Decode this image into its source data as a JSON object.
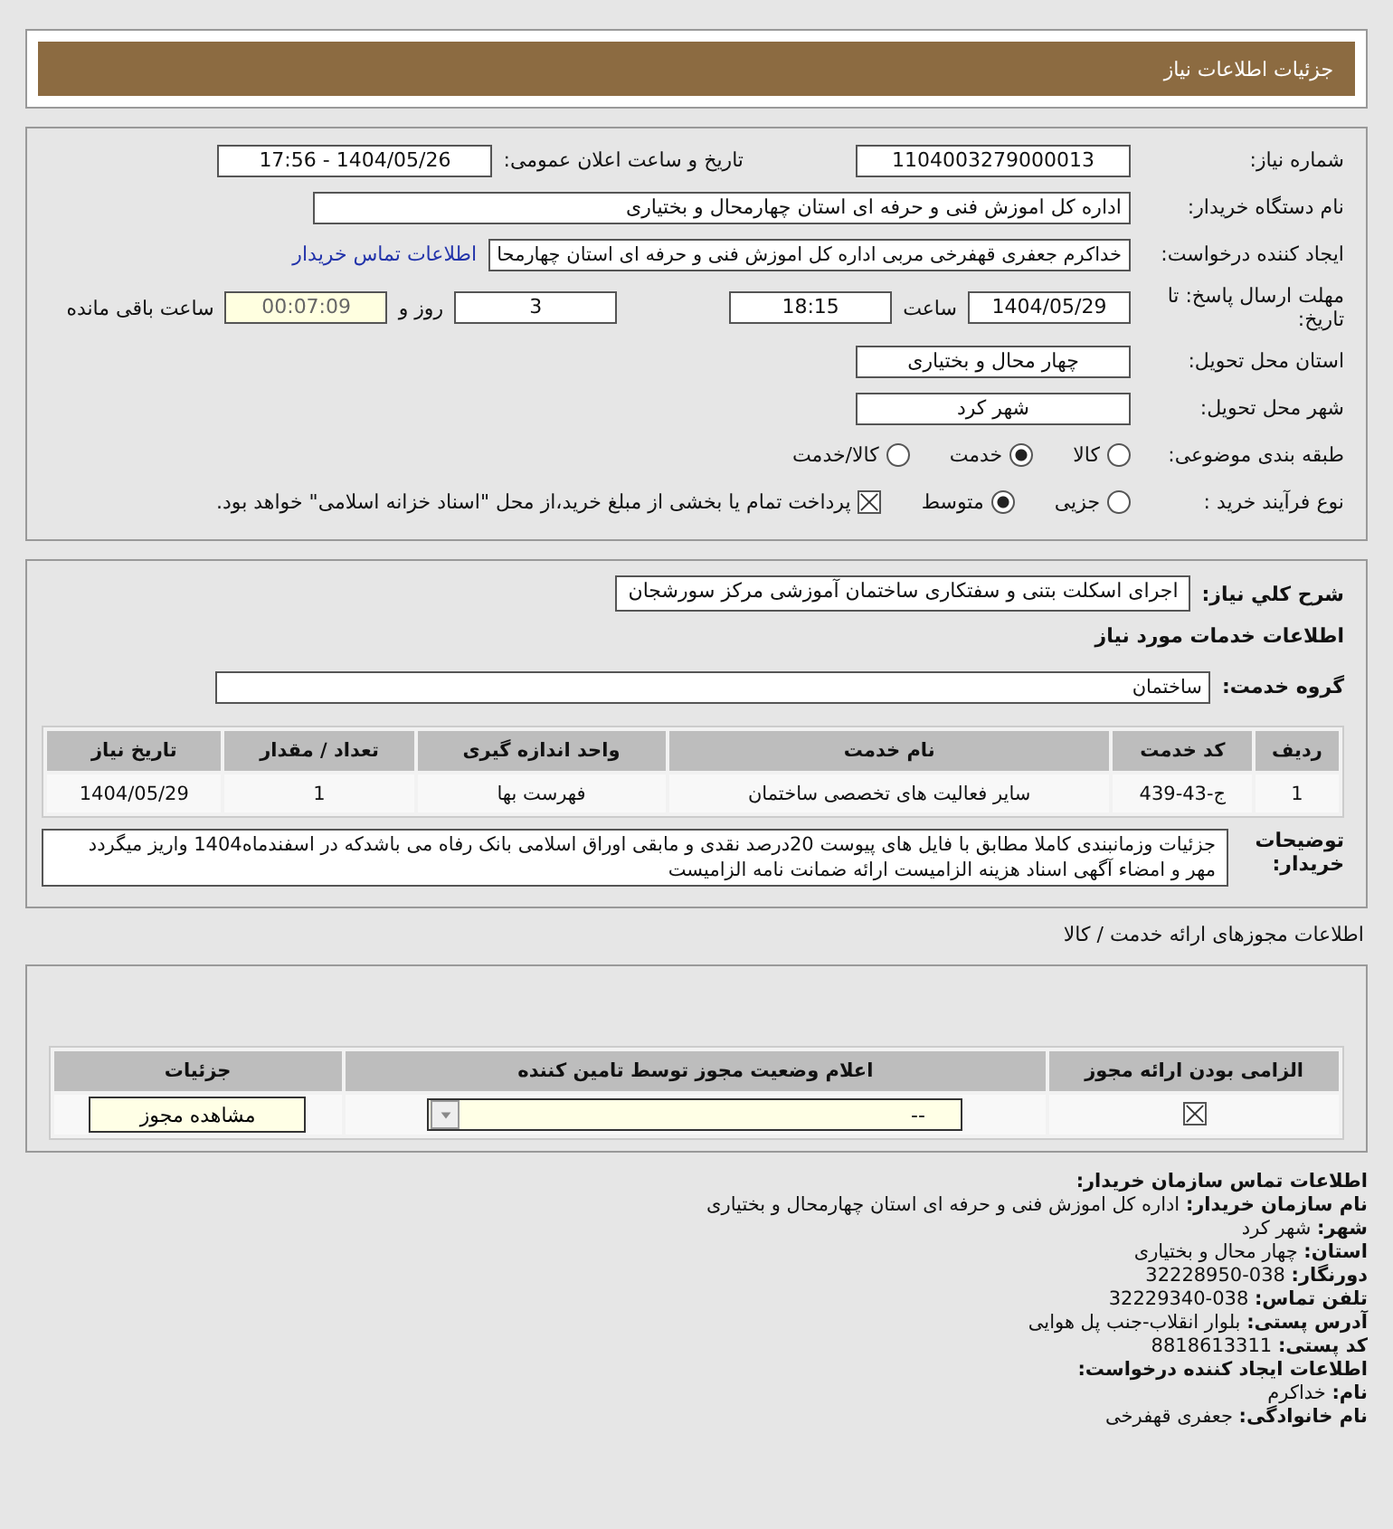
{
  "header": {
    "title": "جزئیات اطلاعات نیاز"
  },
  "form_rows": [
    {
      "items": [
        {
          "kind": "label",
          "text": "شماره نیاز:"
        },
        {
          "kind": "field",
          "value": "1104003279000013"
        },
        {
          "kind": "gap"
        },
        {
          "kind": "text",
          "text": "تاریخ و ساعت اعلان عمومی:"
        },
        {
          "kind": "field",
          "value": "1404/05/26 - 17:56"
        }
      ]
    },
    {
      "items": [
        {
          "kind": "label",
          "text": "نام دستگاه خریدار:"
        },
        {
          "kind": "field",
          "value": "اداره کل اموزش فنی و حرفه ای استان چهارمحال و بختیاری"
        }
      ]
    },
    {
      "items": [
        {
          "kind": "label",
          "text": "ایجاد کننده درخواست:"
        },
        {
          "kind": "field",
          "value": "خداکرم جعفری قهفرخی مربی اداره کل اموزش فنی و حرفه ای استان چهارمحا"
        },
        {
          "kind": "link",
          "text": "اطلاعات تماس خریدار"
        }
      ]
    },
    {
      "items": [
        {
          "kind": "label",
          "text": "مهلت ارسال پاسخ: تا تاریخ:"
        },
        {
          "kind": "field",
          "value": "1404/05/29"
        },
        {
          "kind": "text",
          "text": "ساعت"
        },
        {
          "kind": "field",
          "value": "18:15"
        },
        {
          "kind": "gap"
        },
        {
          "kind": "field",
          "value": "3"
        },
        {
          "kind": "text",
          "text": "روز و"
        },
        {
          "kind": "timer",
          "value": "00:07:09"
        },
        {
          "kind": "text",
          "text": "ساعت باقی مانده"
        }
      ]
    },
    {
      "items": [
        {
          "kind": "label",
          "text": "استان محل تحویل:"
        },
        {
          "kind": "field",
          "value": "چهار محال و بختیاری"
        }
      ]
    },
    {
      "items": [
        {
          "kind": "label",
          "text": "شهر محل تحویل:"
        },
        {
          "kind": "field",
          "value": "شهر کرد"
        }
      ]
    },
    {
      "items": [
        {
          "kind": "label",
          "text": "طبقه بندی موضوعی:"
        },
        {
          "kind": "radio",
          "text": "کالا",
          "selected": false
        },
        {
          "kind": "radio",
          "text": "خدمت",
          "selected": true
        },
        {
          "kind": "radio",
          "text": "کالا/خدمت",
          "selected": false
        }
      ]
    },
    {
      "items": [
        {
          "kind": "label",
          "text": "نوع فرآیند خرید :"
        },
        {
          "kind": "radio",
          "text": "جزیی",
          "selected": false
        },
        {
          "kind": "radio",
          "text": "متوسط",
          "selected": true
        },
        {
          "kind": "checkbox",
          "text": "پرداخت تمام یا بخشی از مبلغ خرید،از محل \"اسناد خزانه اسلامی\" خواهد بود.",
          "checked": true
        }
      ]
    }
  ],
  "need": {
    "label": "شرح کلي نیاز:",
    "value": "اجرای اسکلت بتنی و سفتکاری ساختمان آموزشی مرکز سورشجان"
  },
  "services_title": "اطلاعات خدمات مورد نیاز",
  "service_group": {
    "label": "گروه خدمت:",
    "value": "ساختمان"
  },
  "services_table": {
    "columns": [
      "ردیف",
      "کد خدمت",
      "نام خدمت",
      "واحد اندازه گیری",
      "تعداد / مقدار",
      "تاریخ نیاز"
    ],
    "rows": [
      [
        "1",
        "ج-43-439",
        "سایر فعالیت های تخصصی ساختمان",
        "فهرست بها",
        "1",
        "1404/05/29"
      ]
    ]
  },
  "buyer_notes": {
    "label": "توضیحات خریدار:",
    "text": "جزئیات وزمانبندی کاملا مطابق با فایل های پیوست 20درصد نقدی و مابقی اوراق اسلامی بانک رفاه می باشدکه در اسفندماه1404 واریز میگردد مهر و امضاء آگهی اسناد هزینه الزامیست ارائه ضمانت نامه الزامیست"
  },
  "permits_title": "اطلاعات مجوزهای ارائه خدمت / کالا",
  "permits_table": {
    "columns": [
      "الزامی بودن ارائه مجوز",
      "اعلام وضعیت مجوز توسط تامین کننده",
      "جزئیات"
    ],
    "rows": [
      {
        "required": true,
        "status": "--",
        "action": "مشاهده مجوز"
      }
    ]
  },
  "contact_lines": [
    {
      "kind": "heading",
      "text": "اطلاعات تماس سازمان خریدار:"
    },
    {
      "kind": "line",
      "text": "**نام سازمان خریدار:** اداره کل اموزش فنی و حرفه ای استان چهارمحال و بختیاری"
    },
    {
      "kind": "line",
      "text": "**شهر:** شهر کرد"
    },
    {
      "kind": "line",
      "text": "**استان:** چهار محال و بختیاری"
    },
    {
      "kind": "line",
      "text": "**دورنگار:** 038-32228950"
    },
    {
      "kind": "line",
      "text": "**تلفن تماس:** 038-32229340"
    },
    {
      "kind": "line",
      "text": "**آدرس پستی:** بلوار انقلاب-جنب پل هوایی"
    },
    {
      "kind": "line",
      "text": "**کد پستی:** 8818613311"
    },
    {
      "kind": "heading",
      "text": "اطلاعات ایجاد کننده درخواست:"
    },
    {
      "kind": "line",
      "text": "**نام:** خداکرم"
    },
    {
      "kind": "line",
      "text": "**نام خانوادگی:** جعفری قهفرخی"
    }
  ]
}
